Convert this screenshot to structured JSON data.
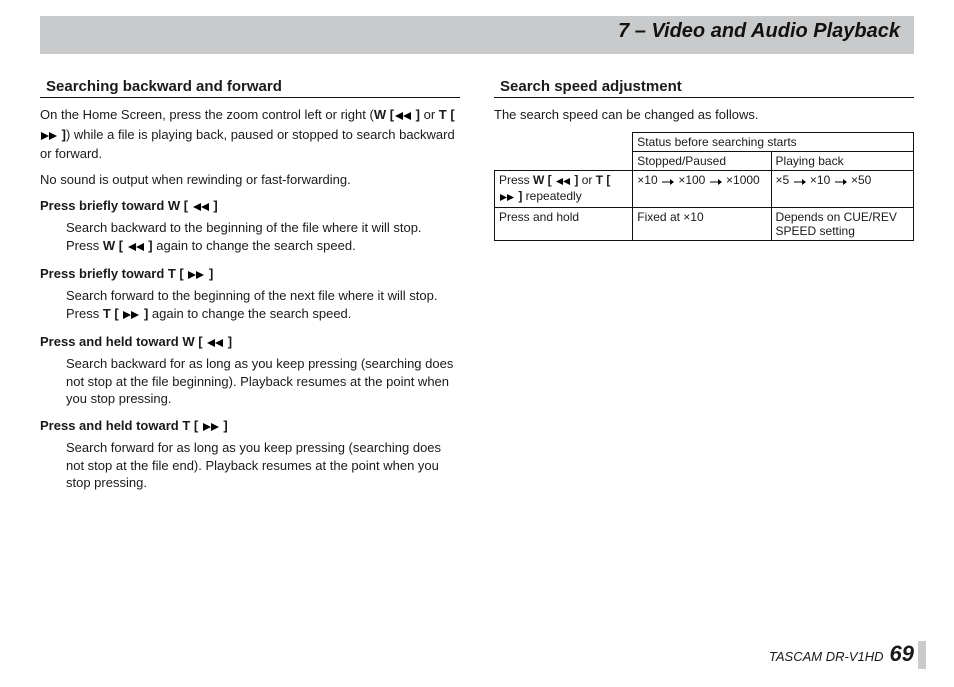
{
  "chapter_title": "7 – Video and Audio Playback",
  "left": {
    "section_title": "Searching backward and forward",
    "intro_before": "On the Home Screen, press the zoom control left or right (",
    "w_label": "W [",
    "w_label_end": " ]",
    "or_text": " or ",
    "t_label": "T [",
    "t_label_end": " ]",
    "intro_after": ") while a file is playing back, paused or stopped to search backward or forward.",
    "no_sound": "No sound is output when rewinding or fast-forwarding.",
    "h1_pre": "Press briefly toward W [ ",
    "h1_post": " ]",
    "h1_body_a": "Search backward to the beginning of the file where it will stop.",
    "h1_body_b_pre": "Press ",
    "h1_body_b_label": "W [ ",
    "h1_body_b_label_end": " ]",
    "h1_body_b_post": " again to change the search speed.",
    "h2_pre": "Press briefly toward T [ ",
    "h2_post": " ]",
    "h2_body_a": "Search forward to the beginning of the next file where it will stop.",
    "h2_body_b_pre": "Press ",
    "h2_body_b_label": "T [ ",
    "h2_body_b_label_end": " ]",
    "h2_body_b_post": " again to change the search speed.",
    "h3_pre": "Press and held toward W [ ",
    "h3_post": " ]",
    "h3_body": "Search backward for as long as you keep pressing (searching does not stop at the file beginning). Playback resumes at the point when you stop pressing.",
    "h4_pre": "Press and held toward T [ ",
    "h4_post": " ]",
    "h4_body": "Search forward for as long as you keep pressing (searching does not stop at the file end). Playback resumes at the point when you stop pressing."
  },
  "right": {
    "section_title": "Search speed adjustment",
    "intro": "The search speed can be changed as follows.",
    "table": {
      "status_header": "Status before searching starts",
      "col_stopped": "Stopped/Paused",
      "col_playing": "Playing back",
      "row1_label_pre": "Press ",
      "row1_label_w": "W [ ",
      "row1_label_w_end": " ]",
      "row1_label_or": " or ",
      "row1_label_t": "T [ ",
      "row1_label_t_end": " ]",
      "row1_label_post": " repeatedly",
      "row1_stopped": [
        "×10",
        "×100",
        "×1000"
      ],
      "row1_playing": [
        "×5",
        "×10",
        "×50"
      ],
      "row2_label": "Press and hold",
      "row2_stopped": "Fixed at ×10",
      "row2_playing": "Depends on CUE/REV SPEED setting"
    }
  },
  "footer_brand": "TASCAM  DR-V1HD",
  "footer_page": "69"
}
